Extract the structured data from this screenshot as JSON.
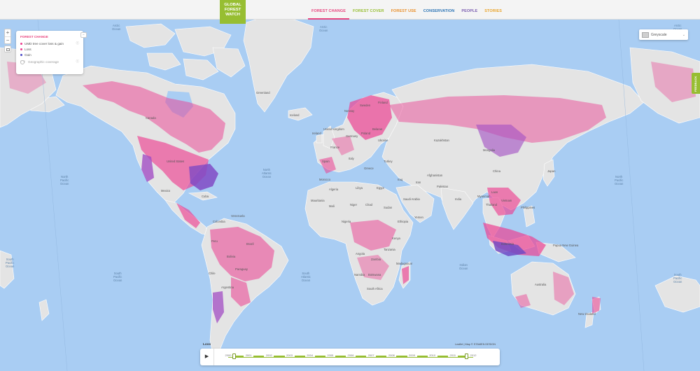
{
  "header": {
    "logo": [
      "GLOBAL",
      "FOREST",
      "WATCH"
    ],
    "nav": [
      {
        "label": "FOREST CHANGE",
        "color": "#e8447e"
      },
      {
        "label": "FOREST COVER",
        "color": "#97be32"
      },
      {
        "label": "FOREST USE",
        "color": "#e98f2b"
      },
      {
        "label": "CONSERVATION",
        "color": "#2a73b5"
      },
      {
        "label": "PEOPLE",
        "color": "#7a5db0"
      },
      {
        "label": "STORIES",
        "color": "#e9a42b"
      }
    ]
  },
  "zoom": {
    "in": "+",
    "out": "−"
  },
  "legend": {
    "title": "FOREST CHANGE",
    "layer": "UMD tree cover loss & gain",
    "info": "ⓘ",
    "items": [
      {
        "label": "Loss",
        "color": "#ec3c8f"
      },
      {
        "label": "Gain",
        "color": "#4a4ac8"
      }
    ],
    "coverage": "Geographic coverage",
    "coverage_info": "ⓘ",
    "collapse": "−"
  },
  "basemap": {
    "label": "Greyscale",
    "icon": "chevron-down-icon",
    "chevron": "⌄"
  },
  "feedback": {
    "label": "FEEDBACK"
  },
  "timeline": {
    "title": "Loss",
    "attribution": "Leaflet | Map © STAMEN DESIGN",
    "play": "▶",
    "years": [
      "2000",
      "2001",
      "2002",
      "2003",
      "2004",
      "2005",
      "2006",
      "2007",
      "2008",
      "2009",
      "2010",
      "2011",
      "2012"
    ],
    "start_year": "2000",
    "end_year": "2012"
  },
  "map": {
    "ocean_color": "#a9cdf3",
    "land_color": "#e4e4e4",
    "loss_color": "#ec3c8f",
    "gain_color": "#4a4ac8",
    "oceans": [
      "Arctic\nOcean",
      "Arctic\nOcean",
      "Arctic\nOcean",
      "North\nPacific\nOcean",
      "North\nAtlantic\nOcean",
      "North\nPacific\nOcean",
      "South\nPacific\nOcean",
      "South\nAtlantic\nOcean",
      "Indian\nOcean",
      "South\nPacific\nOcean",
      "South\nPacific\nOcean"
    ],
    "places": [
      "Greenland",
      "Iceland",
      "Norway",
      "Sweden",
      "Finland",
      "United Kingdom",
      "Ireland",
      "France",
      "Spain",
      "Germany",
      "Poland",
      "Ukraine",
      "Belarus",
      "Italy",
      "Greece",
      "Turkey",
      "Kazakhstan",
      "Mongolia",
      "China",
      "Japan",
      "Iraq",
      "Iran",
      "Afghanistan",
      "Pakistan",
      "India",
      "Saudi Arabia",
      "Yemen",
      "Egypt",
      "Libya",
      "Algeria",
      "Mali",
      "Niger",
      "Chad",
      "Sudan",
      "Ethiopia",
      "Nigeria",
      "Kenya",
      "Tanzania",
      "Angola",
      "Zambia",
      "Namibia",
      "Botswana",
      "South Africa",
      "Madagascar",
      "Mauritania",
      "Morocco",
      "Canada",
      "United States",
      "Mexico",
      "Cuba",
      "Colombia",
      "Venezuela",
      "Peru",
      "Brazil",
      "Bolivia",
      "Chile",
      "Argentina",
      "Paraguay",
      "Australia",
      "New Zealand",
      "Papua New Guinea",
      "Indonesia",
      "Philippines",
      "Thailand",
      "Myanmar",
      "Vietnam",
      "Laos"
    ]
  }
}
